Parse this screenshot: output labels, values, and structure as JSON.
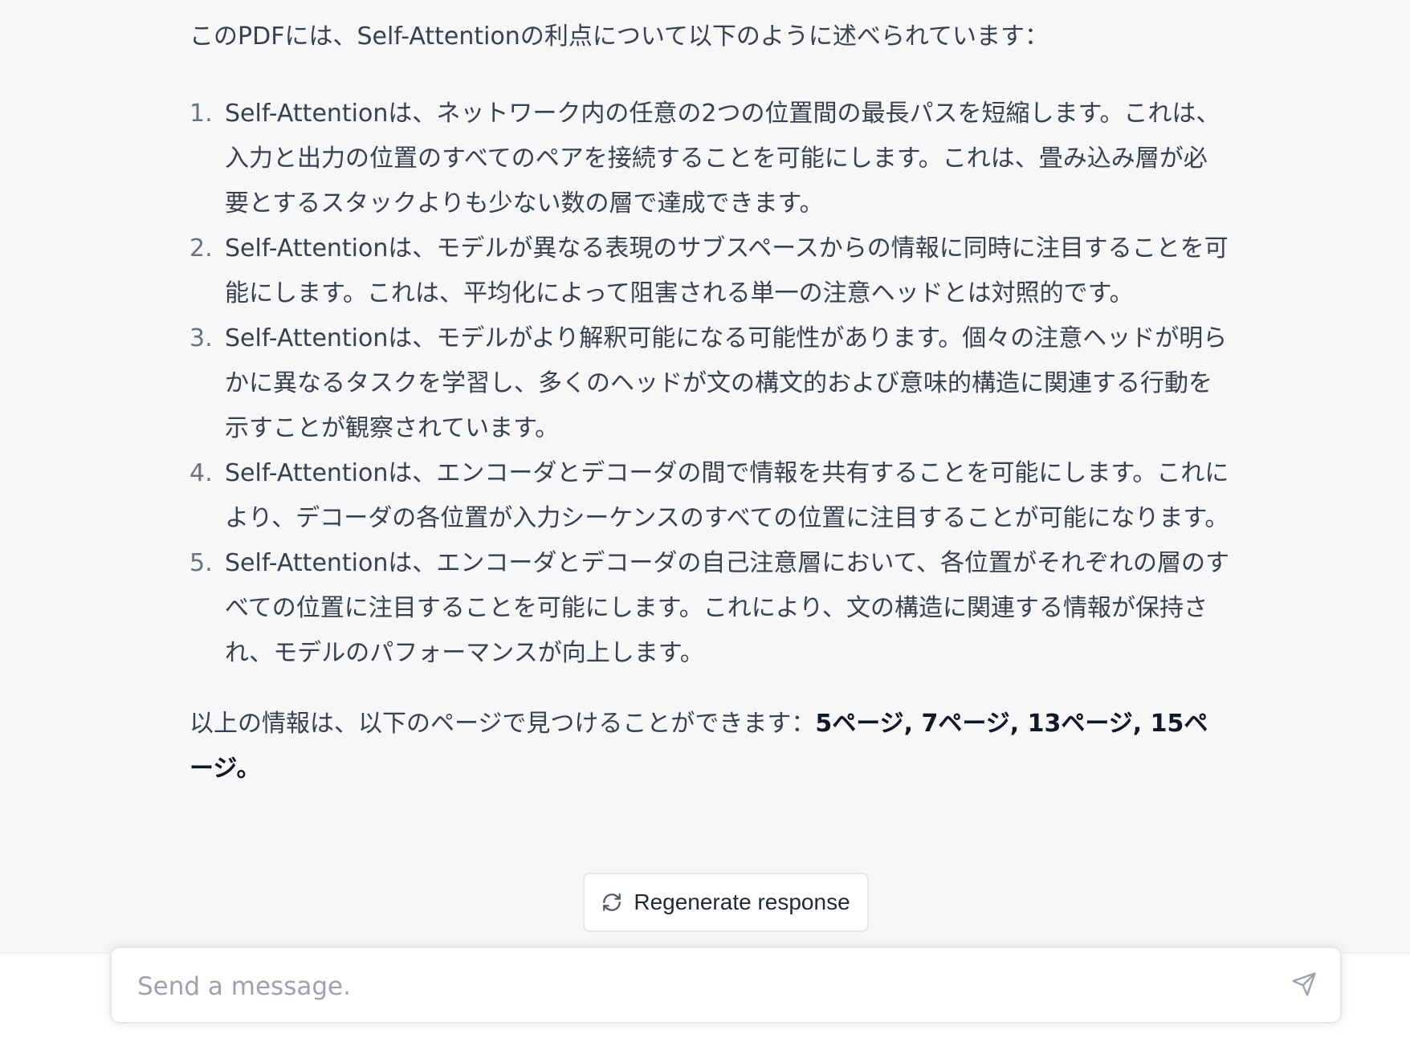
{
  "conversation": {
    "response": {
      "intro": "このPDFには、Self-Attentionの利点について以下のように述べられています：",
      "items": [
        {
          "number": "1.",
          "text": "Self-Attentionは、ネットワーク内の任意の2つの位置間の最長パスを短縮します。これは、入力と出力の位置のすべてのペアを接続することを可能にします。これは、畳み込み層が必要とするスタックよりも少ない数の層で達成できます。"
        },
        {
          "number": "2.",
          "text": "Self-Attentionは、モデルが異なる表現のサブスペースからの情報に同時に注目することを可能にします。これは、平均化によって阻害される単一の注意ヘッドとは対照的です。"
        },
        {
          "number": "3.",
          "text": "Self-Attentionは、モデルがより解釈可能になる可能性があります。個々の注意ヘッドが明らかに異なるタスクを学習し、多くのヘッドが文の構文的および意味的構造に関連する行動を示すことが観察されています。"
        },
        {
          "number": "4.",
          "text": "Self-Attentionは、エンコーダとデコーダの間で情報を共有することを可能にします。これにより、デコーダの各位置が入力シーケンスのすべての位置に注目することが可能になります。"
        },
        {
          "number": "5.",
          "text": "Self-Attentionは、エンコーダとデコーダの自己注意層において、各位置がそれぞれの層のすべての位置に注目することを可能にします。これにより、文の構造に関連する情報が保持され、モデルのパフォーマンスが向上します。"
        }
      ],
      "outro_text": "以上の情報は、以下のページで見つけることができます：",
      "outro_pages": "5ページ, 7ページ, 13ページ, 15ページ。"
    }
  },
  "regenerate": {
    "label": "Regenerate response",
    "icon": "refresh-icon"
  },
  "composer": {
    "placeholder": "Send a message.",
    "value": "",
    "send_icon": "paper-plane-icon"
  },
  "colors": {
    "background": "#f7f7f8",
    "text": "#374151",
    "muted_text": "#6b7280",
    "border": "#e5e7eb"
  }
}
